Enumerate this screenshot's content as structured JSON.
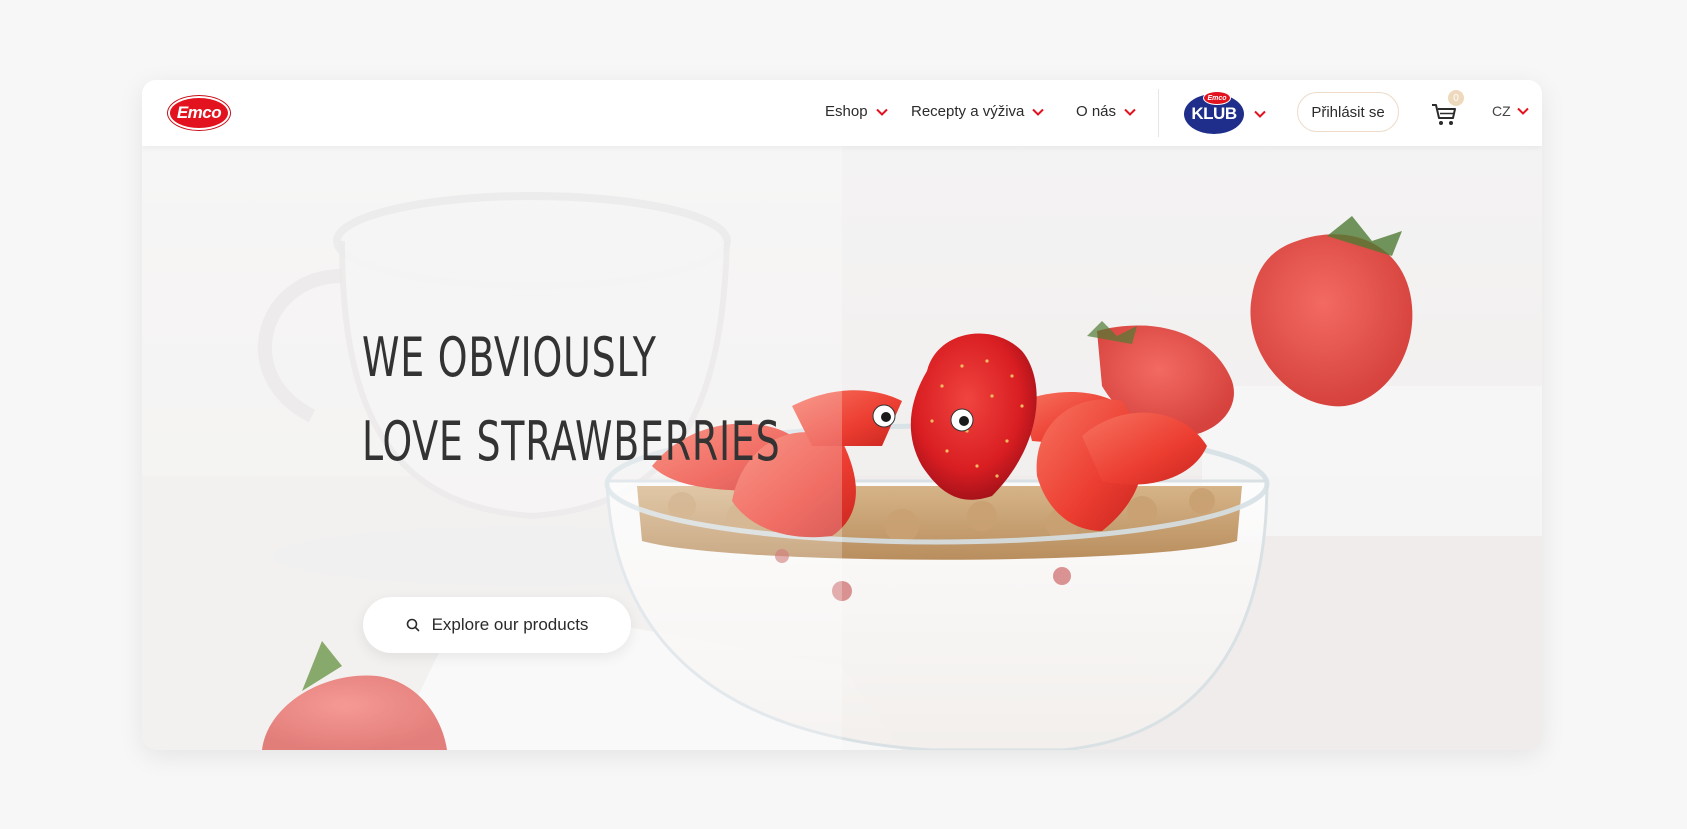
{
  "header": {
    "logo_text": "Emco",
    "nav": [
      {
        "label": "Eshop"
      },
      {
        "label": "Recepty a výživa"
      },
      {
        "label": "O nás"
      }
    ],
    "klub": {
      "badge_text": "Emco",
      "label": "KLUB"
    },
    "login_label": "Přihlásit se",
    "cart_count": "0",
    "language": "CZ"
  },
  "hero": {
    "headline_line1": "WE OBVIOUSLY",
    "headline_line2": "LOVE STRAWBERRIES",
    "cta_label": "Explore our products"
  },
  "colors": {
    "brand_red": "#e2131e",
    "klub_blue": "#1e2e8a",
    "accent_beige": "#ecdcc9",
    "page_bg": "#f7f7f7"
  },
  "icons": [
    "chevron-down-icon",
    "cart-icon",
    "search-icon"
  ]
}
